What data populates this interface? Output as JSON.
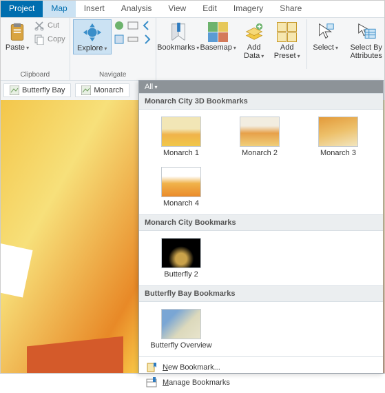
{
  "tabs": {
    "project": "Project",
    "map": "Map",
    "insert": "Insert",
    "analysis": "Analysis",
    "view": "View",
    "edit": "Edit",
    "imagery": "Imagery",
    "share": "Share"
  },
  "ribbon": {
    "clipboard": {
      "paste": "Paste",
      "cut": "Cut",
      "copy": "Copy",
      "label": "Clipboard"
    },
    "navigate": {
      "explore": "Explore",
      "label": "Navigate"
    },
    "bookmarks": {
      "button": "Bookmarks"
    },
    "layer": {
      "basemap": "Basemap",
      "addData": "Add\nData",
      "addPreset": "Add\nPreset"
    },
    "selection": {
      "select": "Select",
      "selectByAttr": "Select By\nAttributes"
    }
  },
  "maptabs": {
    "butterfly": "Butterfly Bay",
    "monarch": "Monarch"
  },
  "dropdown": {
    "filter": "All",
    "sections": {
      "monarch3d": "Monarch City 3D Bookmarks",
      "monarch": "Monarch City Bookmarks",
      "butterfly": "Butterfly Bay Bookmarks"
    },
    "bookmarks": {
      "m1": "Monarch 1",
      "m2": "Monarch 2",
      "m3": "Monarch 3",
      "m4": "Monarch 4",
      "bf2": "Butterfly 2",
      "ov": "Butterfly Overview"
    },
    "commands": {
      "new": "New Bookmark...",
      "manage": "Manage Bookmarks"
    }
  },
  "colors": {
    "accent": "#006eaf"
  }
}
